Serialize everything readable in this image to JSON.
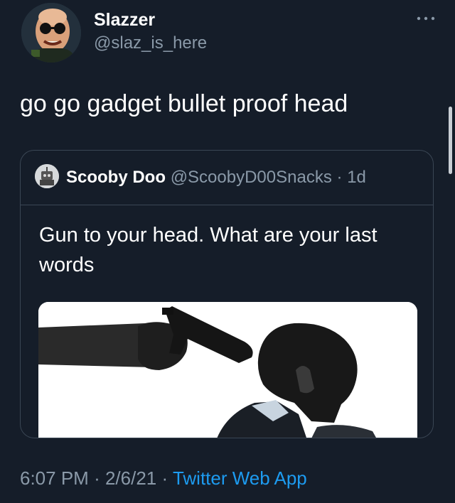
{
  "author": {
    "name": "Slazzer",
    "handle": "@slaz_is_here",
    "avatar_icon": "avatar-bald-sunglasses"
  },
  "more_icon": "more-horizontal-icon",
  "tweet_text": "go go gadget bullet proof head",
  "quoted_tweet": {
    "name": "Scooby Doo",
    "handle": "@ScoobyD00Snacks",
    "separator": "·",
    "age": "1d",
    "avatar_icon": "avatar-robot",
    "text": "Gun to your head. What are your last words",
    "image_icon": "photo-hand-gun-to-head"
  },
  "meta": {
    "time": "6:07 PM",
    "separator": "·",
    "date": "2/6/21",
    "separator2": "·",
    "source": "Twitter Web App"
  },
  "colors": {
    "background": "#151d29",
    "secondary_text": "#8a99a8",
    "link": "#1d9bf0",
    "border": "#3a4654"
  }
}
